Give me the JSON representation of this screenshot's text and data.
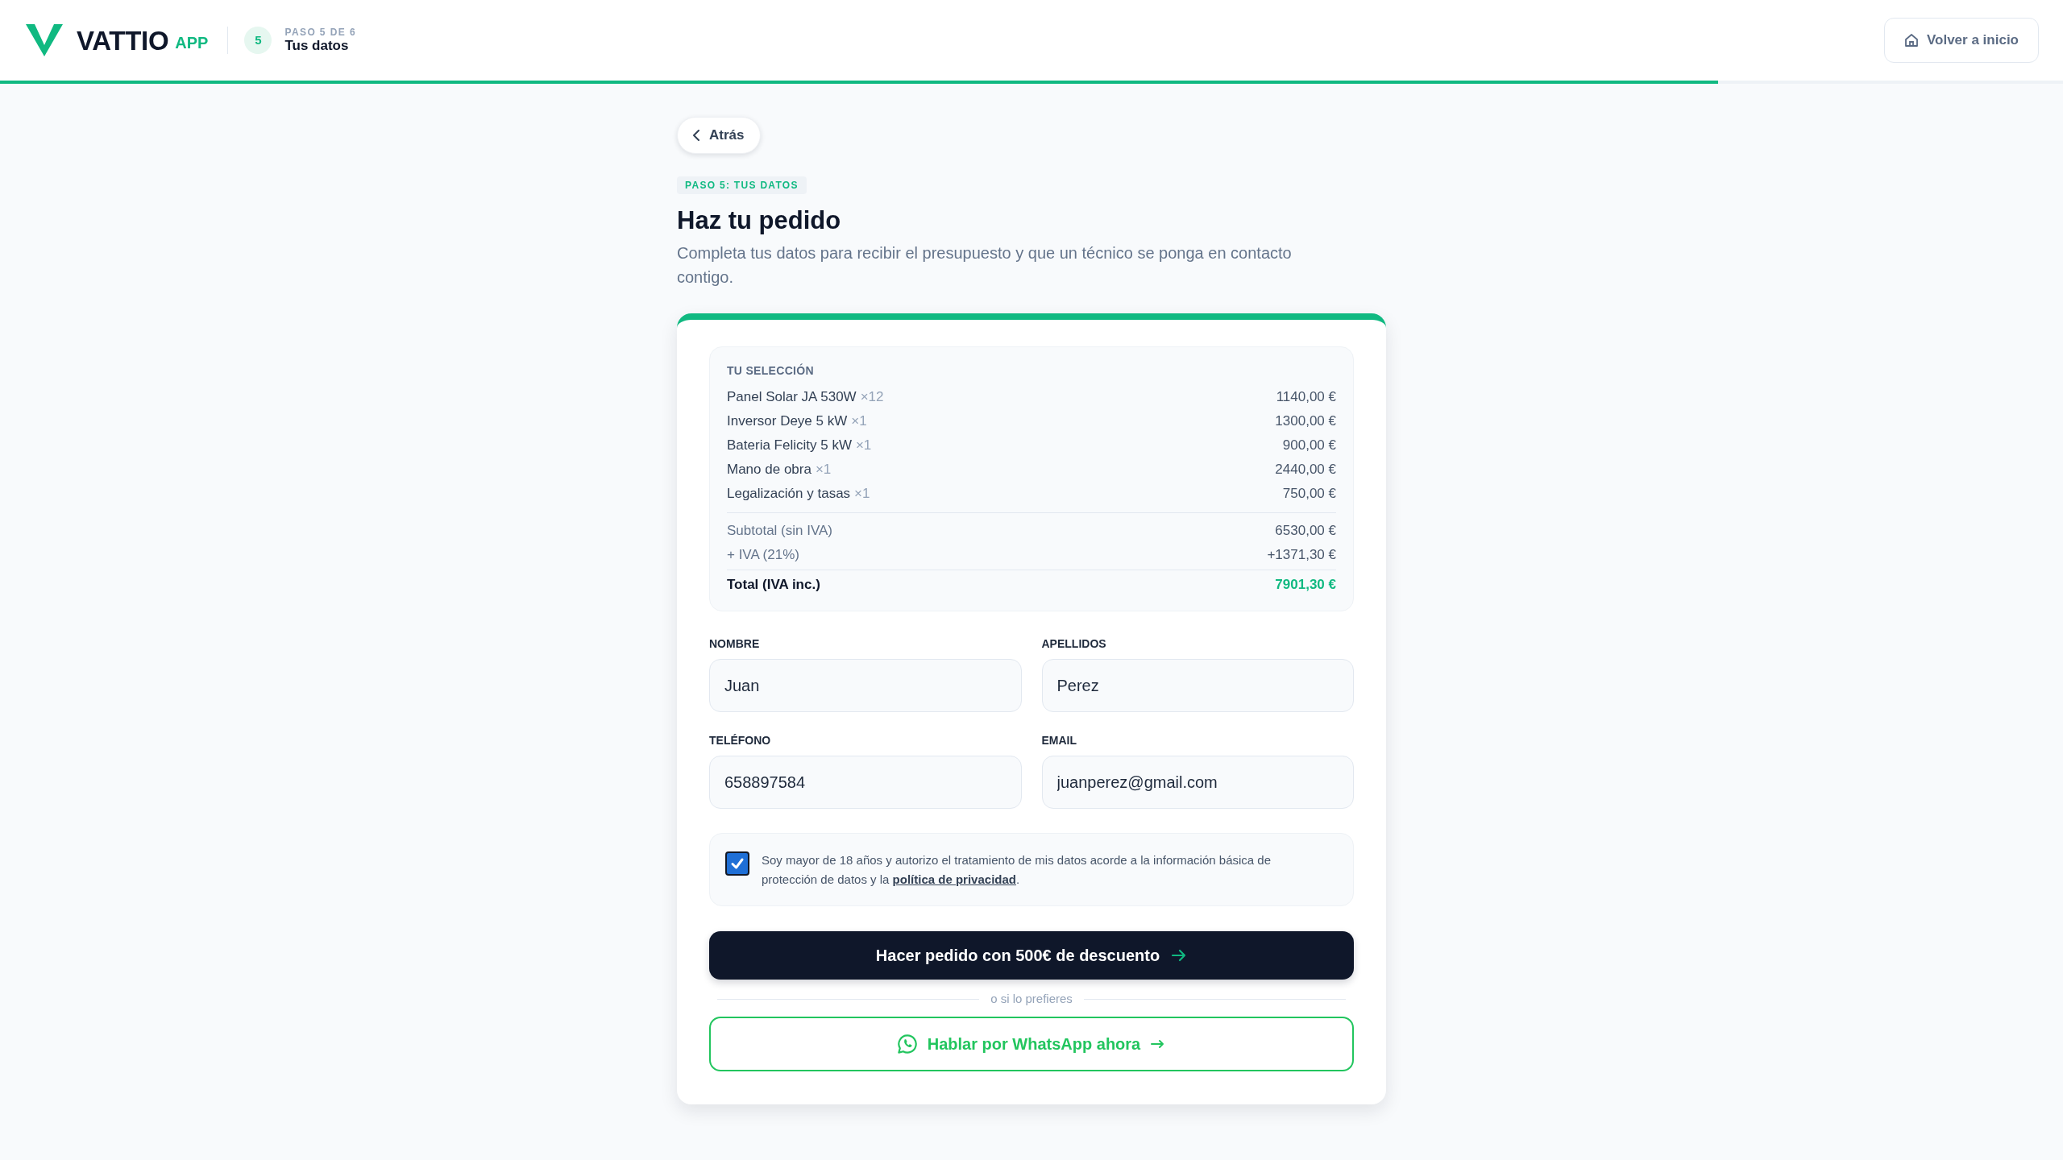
{
  "header": {
    "logo": {
      "name": "VATTIO",
      "suffix": "APP"
    },
    "step": {
      "number": "5",
      "caption": "PASO 5 DE 6",
      "title": "Tus datos"
    },
    "home_button": "Volver a inicio",
    "progress": {
      "level": 0.833
    }
  },
  "back_button": "Atrás",
  "step_badge": "PASO 5: TUS DATOS",
  "title": "Haz tu pedido",
  "subtitle": "Completa tus datos para recibir el presupuesto y que un técnico se ponga en contacto contigo.",
  "selection": {
    "heading": "TU SELECCIÓN",
    "items": [
      {
        "name": "Panel Solar JA 530W",
        "quantity": "×12",
        "price": "1140,00 €"
      },
      {
        "name": "Inversor Deye 5 kW",
        "quantity": "×1",
        "price": "1300,00 €"
      },
      {
        "name": "Bateria Felicity 5 kW",
        "quantity": "×1",
        "price": "900,00 €"
      },
      {
        "name": "Mano de obra",
        "quantity": "×1",
        "price": "2440,00 €"
      },
      {
        "name": "Legalización y tasas",
        "quantity": "×1",
        "price": "750,00 €"
      }
    ],
    "summary": [
      {
        "kind": "subtotal",
        "label": "Subtotal (sin IVA)",
        "value": "6530,00 €"
      },
      {
        "kind": "tax",
        "label": "+ IVA (21%)",
        "value": "+1371,30 €"
      },
      {
        "kind": "total",
        "label": "Total (IVA inc.)",
        "value": "7901,30 €"
      }
    ]
  },
  "form": {
    "fields": [
      {
        "label": "NOMBRE",
        "value": "Juan"
      },
      {
        "label": "APELLIDOS",
        "value": "Perez"
      },
      {
        "label": "TELÉFONO",
        "value": "658897584"
      },
      {
        "label": "EMAIL",
        "value": "juanperez@gmail.com"
      }
    ]
  },
  "consent": {
    "checked": true,
    "text": "Soy mayor de 18 años y autorizo el tratamiento de mis datos acorde a la información básica de protección de datos y la ",
    "link": "política de privacidad",
    "text_after": "."
  },
  "order_button": "Hacer pedido con 500€ de descuento",
  "divider_text": "o si lo prefieres",
  "whatsapp_button": "Hablar por WhatsApp ahora"
}
